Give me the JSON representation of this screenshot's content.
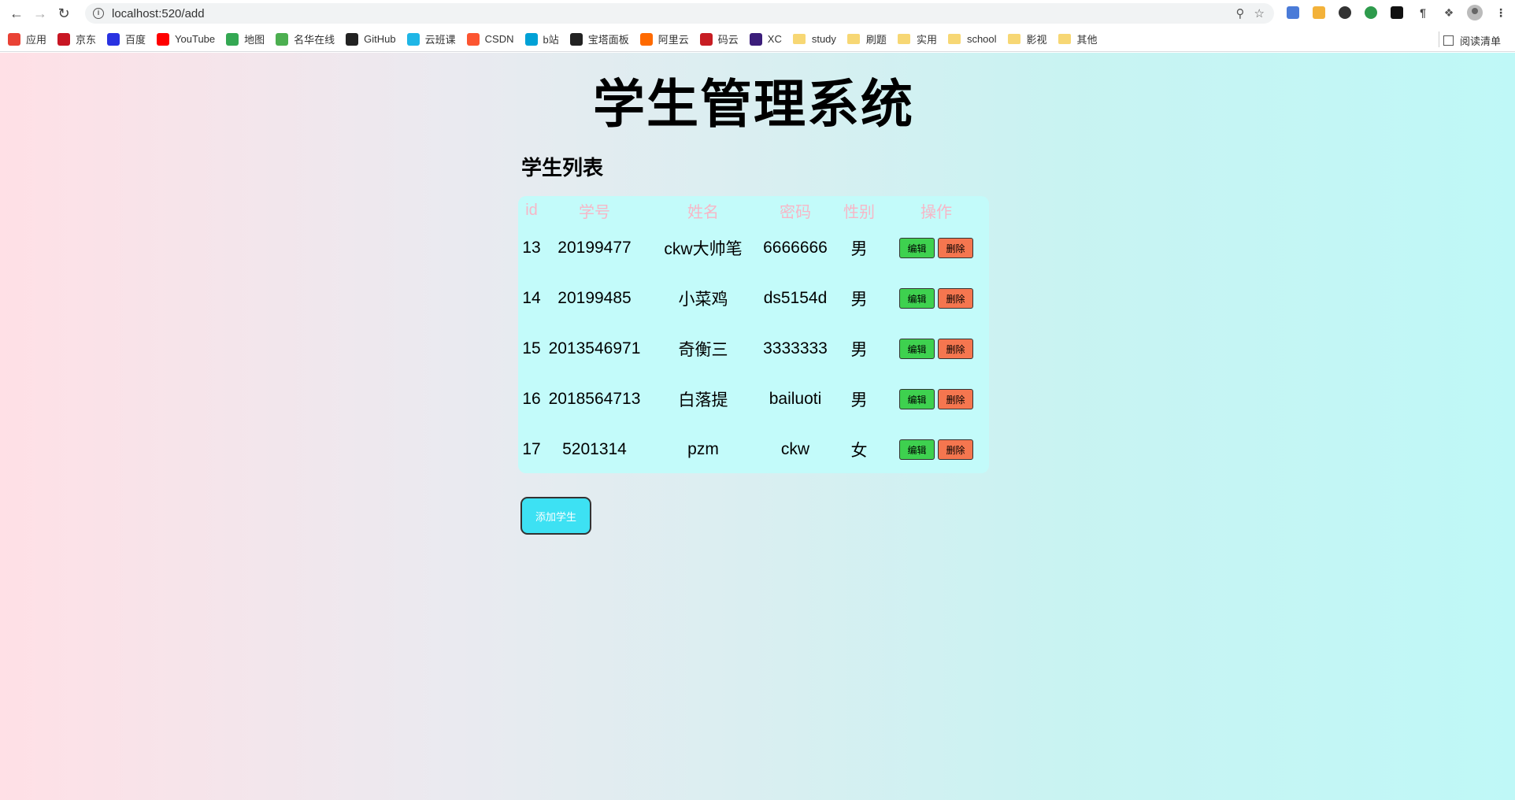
{
  "browser": {
    "url": "localhost:520/add",
    "bookmarks": [
      {
        "label": "应用",
        "color": "#e94235"
      },
      {
        "label": "京东",
        "color": "#c81623"
      },
      {
        "label": "百度",
        "color": "#2932e1"
      },
      {
        "label": "YouTube",
        "color": "#ff0000"
      },
      {
        "label": "地图",
        "color": "#34a853"
      },
      {
        "label": "名华在线",
        "color": "#4caf50"
      },
      {
        "label": "GitHub",
        "color": "#222222"
      },
      {
        "label": "云班课",
        "color": "#1fb6e6"
      },
      {
        "label": "CSDN",
        "color": "#fc5531"
      },
      {
        "label": "b站",
        "color": "#00a1d6"
      },
      {
        "label": "宝塔面板",
        "color": "#222222"
      },
      {
        "label": "阿里云",
        "color": "#ff6a00"
      },
      {
        "label": "码云",
        "color": "#c71d23"
      },
      {
        "label": "XC",
        "color": "#3b1d7a"
      }
    ],
    "folders": [
      "study",
      "刷题",
      "实用",
      "school",
      "影视",
      "其他"
    ],
    "reading_list": "阅读清单"
  },
  "page": {
    "title": "学生管理系统",
    "subtitle": "学生列表",
    "columns": [
      "id",
      "学号",
      "姓名",
      "密码",
      "性别",
      "操作"
    ],
    "rows": [
      {
        "id": "13",
        "sno": "20199477",
        "name": "ckw大帅笔",
        "password": "6666666",
        "gender": "男"
      },
      {
        "id": "14",
        "sno": "20199485",
        "name": "小菜鸡",
        "password": "ds5154d",
        "gender": "男"
      },
      {
        "id": "15",
        "sno": "2013546971",
        "name": "奇衡三",
        "password": "3333333",
        "gender": "男"
      },
      {
        "id": "16",
        "sno": "2018564713",
        "name": "白落提",
        "password": "bailuoti",
        "gender": "男"
      },
      {
        "id": "17",
        "sno": "5201314",
        "name": "pzm",
        "password": "ckw",
        "gender": "女"
      }
    ],
    "edit_label": "编辑",
    "delete_label": "删除",
    "add_label": "添加学生",
    "colors": {
      "header_text": "#f7b6c6",
      "table_bg": "#c3fbfa",
      "edit_btn": "#3ed14f",
      "delete_btn": "#f5764f",
      "add_btn": "#3de1f3"
    }
  }
}
